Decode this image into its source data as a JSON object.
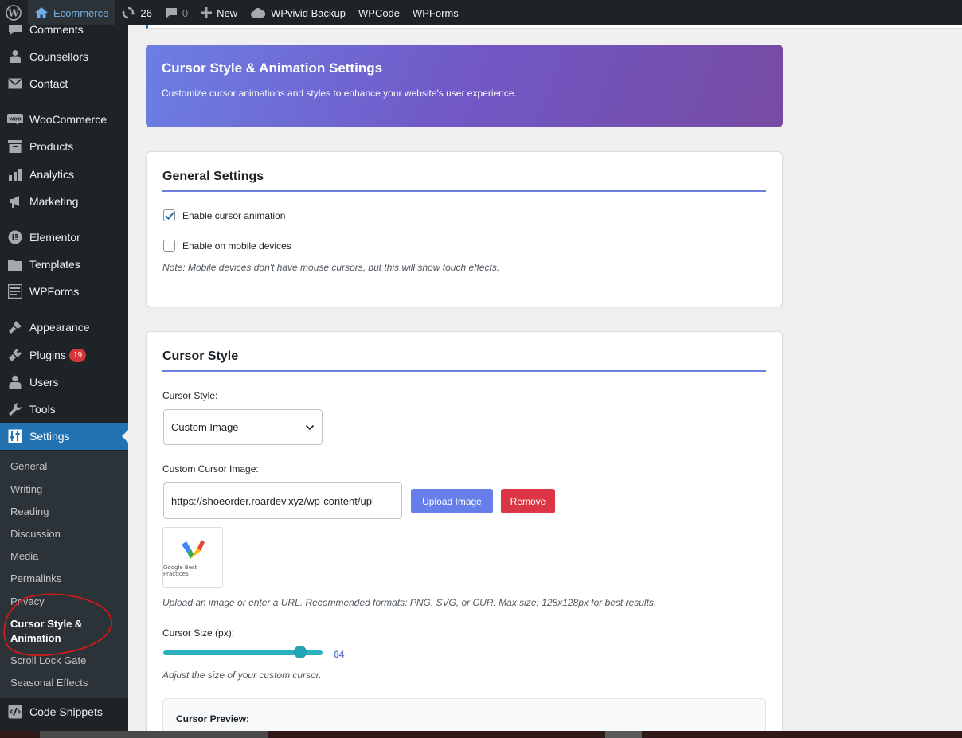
{
  "adminbar": {
    "site_name": "Ecommerce",
    "updates_count": "26",
    "comments_count": "0",
    "new_label": "New",
    "backup_label": "WPvivid Backup",
    "wpcode_label": "WPCode",
    "wpforms_label": "WPForms"
  },
  "sidebar": {
    "items": [
      {
        "label": "Comments",
        "icon": "comment-icon"
      },
      {
        "label": "Counsellors",
        "icon": "person-icon"
      },
      {
        "label": "Contact",
        "icon": "mail-icon"
      },
      {
        "label": "WooCommerce",
        "icon": "woo-icon"
      },
      {
        "label": "Products",
        "icon": "archive-icon"
      },
      {
        "label": "Analytics",
        "icon": "bar-chart-icon"
      },
      {
        "label": "Marketing",
        "icon": "megaphone-icon"
      },
      {
        "label": "Elementor",
        "icon": "elementor-icon"
      },
      {
        "label": "Templates",
        "icon": "folder-icon"
      },
      {
        "label": "WPForms",
        "icon": "form-icon"
      },
      {
        "label": "Appearance",
        "icon": "brush-icon"
      },
      {
        "label": "Plugins",
        "icon": "plugin-icon",
        "badge": "19"
      },
      {
        "label": "Users",
        "icon": "users-icon"
      },
      {
        "label": "Tools",
        "icon": "wrench-icon"
      },
      {
        "label": "Settings",
        "icon": "settings-icon"
      },
      {
        "label": "Code Snippets",
        "icon": "code-icon"
      }
    ],
    "submenu": [
      "General",
      "Writing",
      "Reading",
      "Discussion",
      "Media",
      "Permalinks",
      "Privacy",
      "Cursor Style &",
      "Animation",
      "Scroll Lock Gate",
      "Seasonal Effects"
    ]
  },
  "hero": {
    "title": "Cursor Style & Animation Settings",
    "subtitle": "Customize cursor animations and styles to enhance your website's user experience."
  },
  "general": {
    "title": "General Settings",
    "enable_animation_label": "Enable cursor animation",
    "enable_animation_checked": true,
    "enable_mobile_label": "Enable on mobile devices",
    "enable_mobile_checked": false,
    "note": "Note: Mobile devices don't have mouse cursors, but this will show touch effects."
  },
  "cursor_style": {
    "title": "Cursor Style",
    "style_label": "Cursor Style:",
    "style_value": "Custom Image",
    "image_label": "Custom Cursor Image:",
    "image_url": "https://shoeorder.roardev.xyz/wp-content/upl",
    "upload_label": "Upload Image",
    "remove_label": "Remove",
    "thumbnail_caption": "Google Best Practices",
    "help_text": "Upload an image or enter a URL. Recommended formats: PNG, SVG, or CUR. Max size: 128x128px for best results.",
    "size_label": "Cursor Size (px):",
    "size_value": "64",
    "size_help": "Adjust the size of your custom cursor.",
    "preview_label": "Cursor Preview:"
  },
  "colors": {
    "admin_dark": "#1d2327",
    "wp_blue": "#2271b1",
    "accent": "#667eea",
    "danger": "#dc3545",
    "badge_red": "#d63638",
    "slider": "#2bb0bf"
  }
}
